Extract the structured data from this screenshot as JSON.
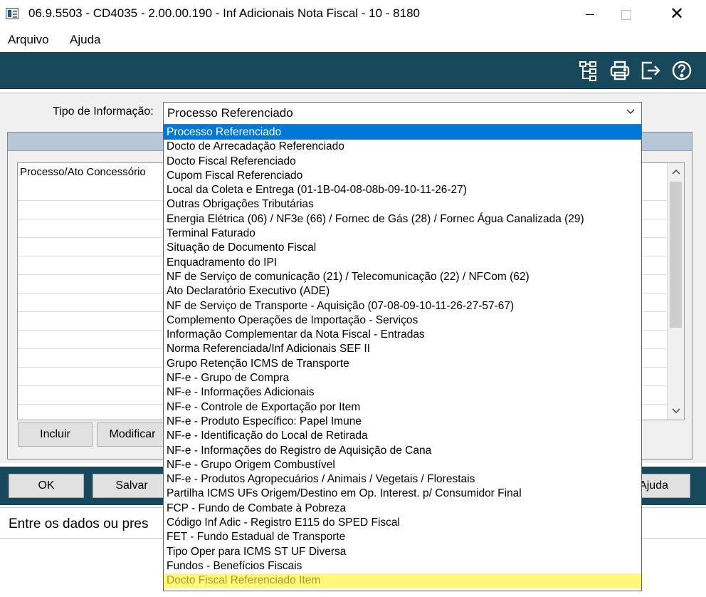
{
  "window": {
    "title": "06.9.5503 - CD4035 - 2.00.00.190 - Inf Adicionais Nota Fiscal - 10 - 8180",
    "close_glyph": "✕"
  },
  "menu": {
    "items": [
      "Arquivo",
      "Ajuda"
    ]
  },
  "toolbar": {
    "icons": [
      "tree-structure-icon",
      "print-icon",
      "exit-icon",
      "help-icon"
    ]
  },
  "form": {
    "tipo_label": "Tipo de Informação:",
    "tipo_value": "Processo Referenciado",
    "grid_column": "Processo/Ato Concessório"
  },
  "buttons": {
    "incluir": "Incluir",
    "modificar": "Modificar",
    "ok": "OK",
    "salvar": "Salvar",
    "ajuda": "Ajuda"
  },
  "status": {
    "text": "Entre os dados ou pres"
  },
  "dropdown": {
    "selected_index": 0,
    "highlighted_index": 31,
    "options": [
      "Processo Referenciado",
      "Docto de Arrecadação Referenciado",
      "Docto Fiscal Referenciado",
      "Cupom Fiscal Referenciado",
      "Local da Coleta e Entrega (01-1B-04-08-08b-09-10-11-26-27)",
      "Outras Obrigações Tributárias",
      "Energia Elétrica (06) / NF3e (66) / Fornec de Gás (28) / Fornec Água Canalizada (29)",
      "Terminal Faturado",
      "Situação de Documento Fiscal",
      "Enquadramento do IPI",
      "NF de Serviço de comunicação (21) / Telecomunicação (22) / NFCom (62)",
      "Ato Declaratório Executivo (ADE)",
      "NF de Serviço de Transporte - Aquisição (07-08-09-10-11-26-27-57-67)",
      "Complemento Operações de Importação - Serviços",
      "Informação Complementar da Nota Fiscal - Entradas",
      "Norma Referenciada/Inf Adicionais SEF II",
      "Grupo Retenção ICMS de Transporte",
      "NF-e - Grupo de Compra",
      "NF-e - Informações Adicionais",
      "NF-e - Controle de Exportação por Item",
      "NF-e - Produto Específico: Papel Imune",
      "NF-e - Identificação do Local de Retirada",
      "NF-e - Informações do Registro de Aquisição de Cana",
      "NF-e - Grupo Origem Combustível",
      "NF-e - Produtos Agropecuários / Animais / Vegetais / Florestais",
      "Partilha ICMS UFs Origem/Destino em Op. Interest. p/ Consumidor Final",
      "FCP - Fundo de Combate à Pobreza",
      "Código Inf Adic - Registro E115 do SPED Fiscal",
      "FET - Fundo Estadual de Transporte",
      "Tipo Oper para ICMS ST UF Diversa",
      "Fundos - Benefícios Fiscais",
      "Docto Fiscal Referenciado Item"
    ]
  }
}
